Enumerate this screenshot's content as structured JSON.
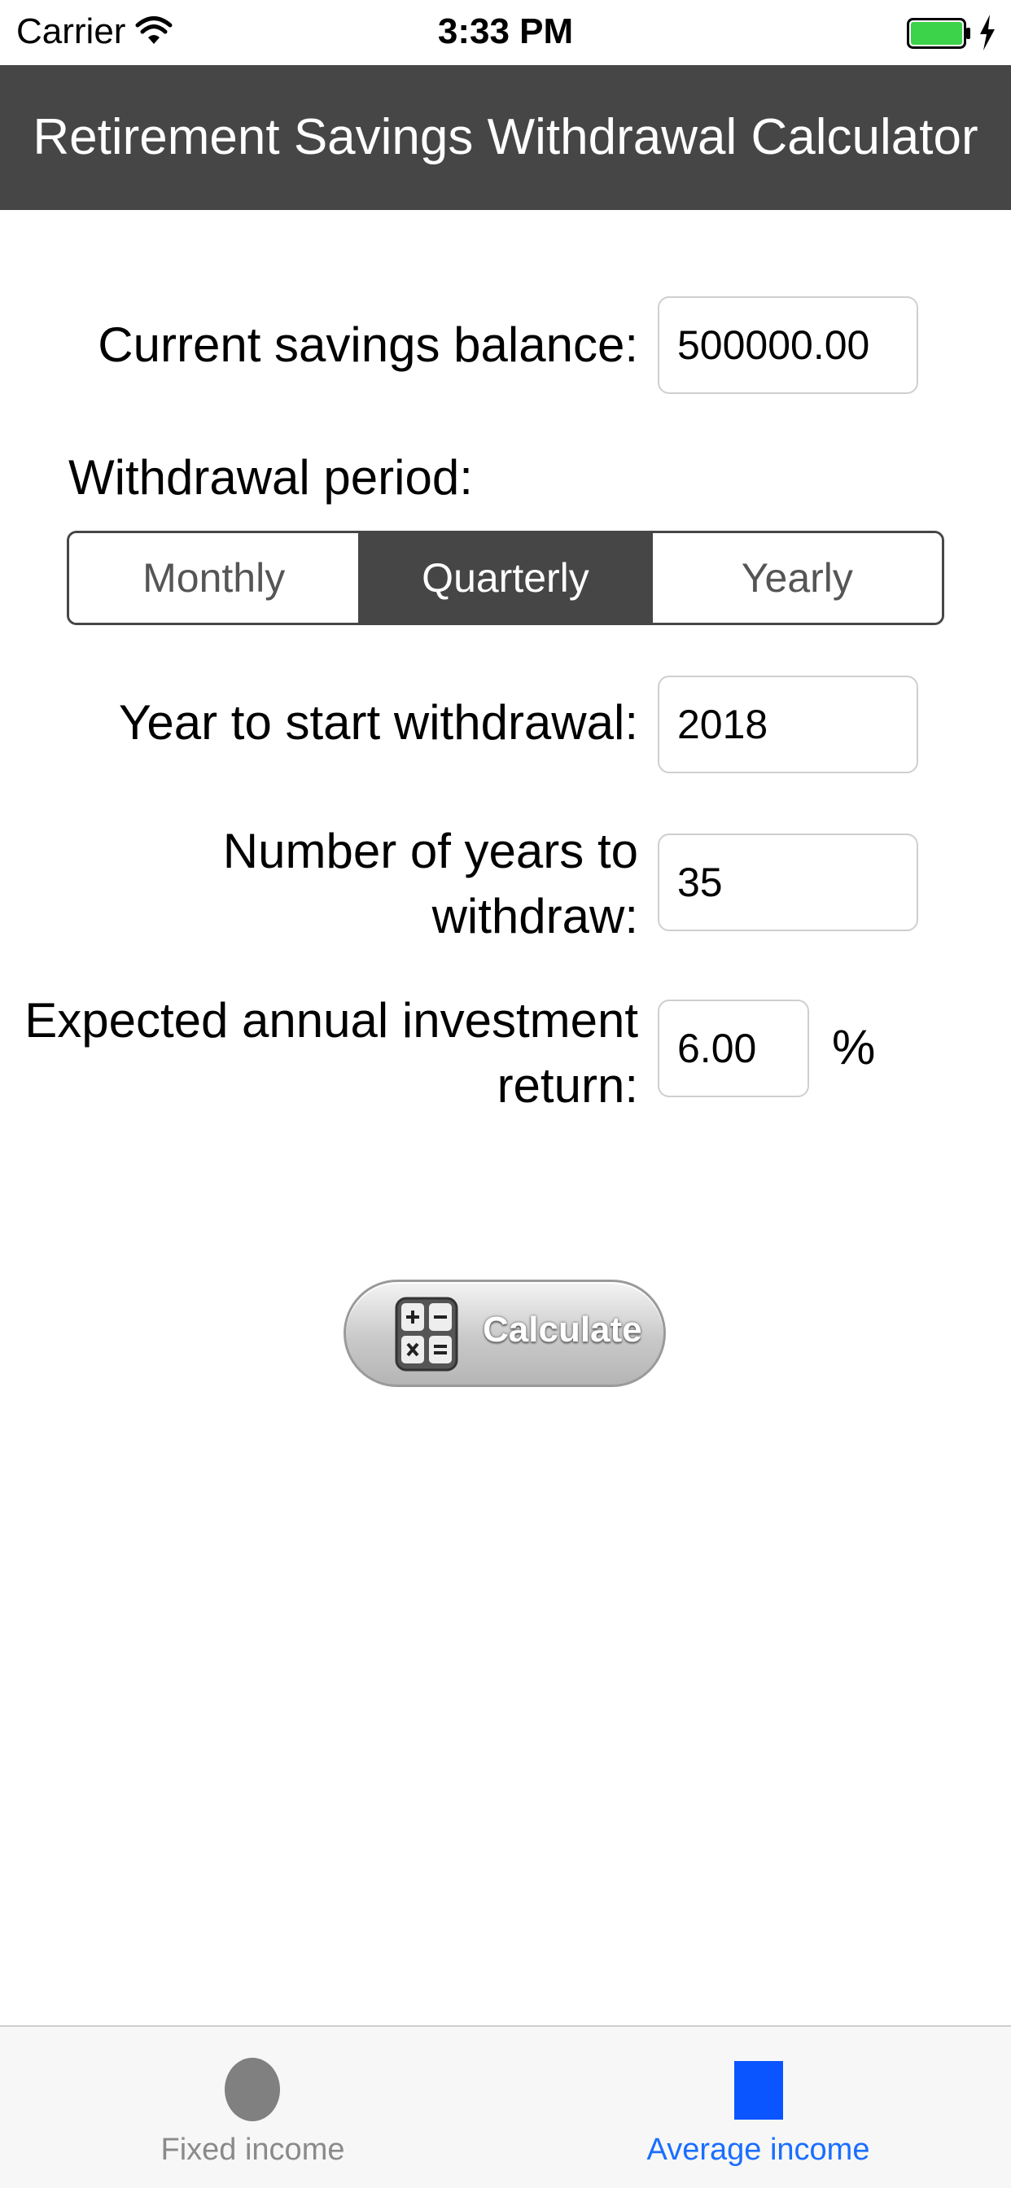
{
  "status_bar": {
    "carrier": "Carrier",
    "time": "3:33 PM",
    "battery_color": "#3cd24a"
  },
  "nav": {
    "title": "Retirement Savings Withdrawal Calculator"
  },
  "form": {
    "savings_label": "Current savings balance:",
    "savings_value": "500000.00",
    "period_label": "Withdrawal period:",
    "period_options": [
      "Monthly",
      "Quarterly",
      "Yearly"
    ],
    "period_selected": "Quarterly",
    "start_year_label": "Year to start withdrawal:",
    "start_year_value": "2018",
    "years_label_line1": "Number of years to",
    "years_label_line2": "withdraw:",
    "years_value": "35",
    "return_label_line1": "Expected annual investment",
    "return_label_line2": "return:",
    "return_value": "6.00",
    "return_unit": "%"
  },
  "calculate_button": {
    "label": "Calculate",
    "icon": "calculator-icon"
  },
  "tab_bar": {
    "tabs": [
      {
        "label": "Fixed income",
        "icon": "circle-icon",
        "selected": false
      },
      {
        "label": "Average income",
        "icon": "square-icon",
        "selected": true
      }
    ],
    "active_color": "#1a6eff",
    "inactive_color": "#8a8a8a"
  }
}
